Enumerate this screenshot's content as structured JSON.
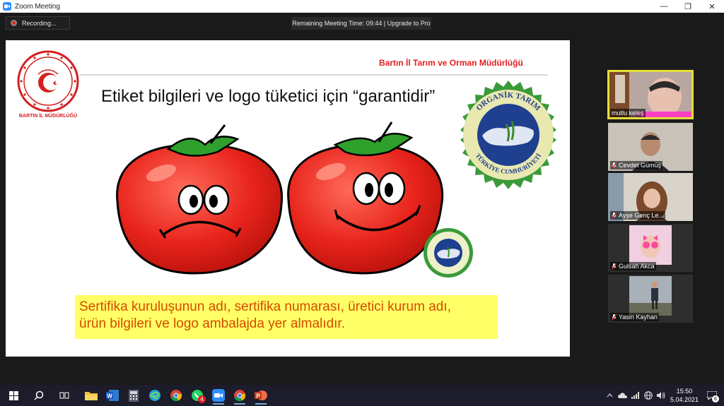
{
  "window": {
    "title": "Zoom Meeting",
    "controls": {
      "minimize": "—",
      "maximize": "❐",
      "close": "✕"
    }
  },
  "toolbar": {
    "recording_label": "Recording...",
    "timer_text": "Remaining Meeting Time: 09:44 | Upgrade to Pro"
  },
  "slide": {
    "organization": "Bartın İl Tarım ve Orman Müdürlüğü",
    "emblem_label": "BARTIN İL MÜDÜRLÜĞÜ",
    "heading": "Etiket bilgileri ve logo tüketici için “garantidir”",
    "seal_top": "ORGANİK TARIM",
    "seal_bottom": "TÜRKİYE CUMHURİYETİ",
    "caption_lines": [
      "Sertifika kuruluşunun adı, sertifika numarası, üretici kurum adı,",
      "ürün bilgileri  ve logo ambalajda yer almalıdır."
    ]
  },
  "participants": [
    {
      "name": "mutlu keleş",
      "muted": false,
      "active": true
    },
    {
      "name": "Cevdet Gümüş",
      "muted": true,
      "active": false
    },
    {
      "name": "Ayşe Genç Le...",
      "muted": true,
      "active": false
    },
    {
      "name": "Gulsah Akca",
      "muted": true,
      "active": false
    },
    {
      "name": "Yasin Kayhan",
      "muted": true,
      "active": false
    }
  ],
  "taskbar": {
    "whatsapp_badge": "4",
    "time": "15:50",
    "date": "5.04.2021",
    "notification_count": "6"
  },
  "colors": {
    "accent_red": "#e02020",
    "caption_bg": "#ffff66",
    "caption_text": "#d64a00",
    "active_speaker": "#e6dc3c",
    "zoom_blue": "#2d8cff"
  }
}
